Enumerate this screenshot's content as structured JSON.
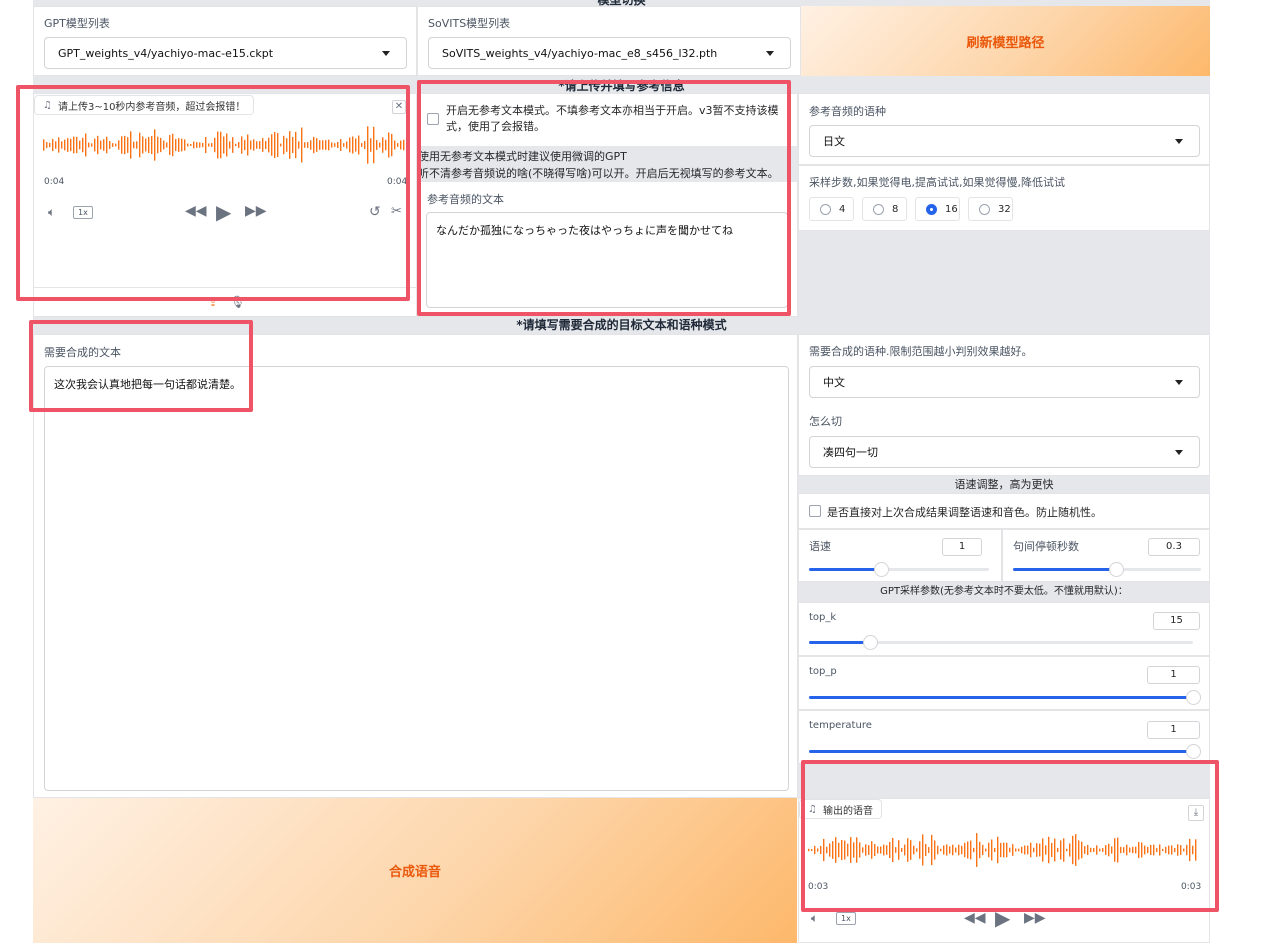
{
  "model_switch": {
    "header": "模型切换",
    "gpt_label": "GPT模型列表",
    "gpt_value": "GPT_weights_v4/yachiyo-mac-e15.ckpt",
    "sovits_label": "SoVITS模型列表",
    "sovits_value": "SoVITS_weights_v4/yachiyo-mac_e8_s456_l32.pth",
    "refresh_label": "刷新模型路径"
  },
  "reference": {
    "header": "*请上传并填写参考信息",
    "audio_tag": "请上传3~10秒内参考音频，超过会报错！",
    "audio_time_start": "0:04",
    "audio_time_end": "0:04",
    "rate": "1x",
    "no_ref_text_label": "开启无参考文本模式。不填参考文本亦相当于开启。v3暂不支持该模式，使用了会报错。",
    "no_ref_hint_1": "使用无参考文本模式时建议使用微调的GPT",
    "no_ref_hint_2": "听不清参考音频说的啥(不晓得写啥)可以开。开启后无视填写的参考文本。",
    "ref_text_label": "参考音频的文本",
    "ref_text_value": "なんだか孤独になっちゃった夜はやっちょに声を聞かせてね",
    "ref_lang_label": "参考音频的语种",
    "ref_lang_value": "日文",
    "steps_label": "采样步数,如果觉得电,提高试试,如果觉得慢,降低试试",
    "steps_options": [
      "4",
      "8",
      "16",
      "32"
    ],
    "steps_selected": "16"
  },
  "target": {
    "header": "*请填写需要合成的目标文本和语种模式",
    "text_label": "需要合成的文本",
    "text_value": "这次我会认真地把每一句话都说清楚。",
    "lang_label": "需要合成的语种.限制范围越小判别效果越好。",
    "lang_value": "中文",
    "cut_label": "怎么切",
    "cut_value": "凑四句一切",
    "speed_header": "语速调整，高为更快",
    "direct_adjust_label": "是否直接对上次合成结果调整语速和音色。防止随机性。",
    "speed_label": "语速",
    "speed_value": "1",
    "speed_fraction": 0.4,
    "pause_label": "句间停顿秒数",
    "pause_value": "0.3",
    "pause_fraction": 0.55,
    "gpt_params_header": "GPT采样参数(无参考文本时不要太低。不懂就用默认)：",
    "top_k_label": "top_k",
    "top_k_value": "15",
    "top_k_fraction": 0.16,
    "top_p_label": "top_p",
    "top_p_value": "1",
    "top_p_fraction": 1.0,
    "temperature_label": "temperature",
    "temperature_value": "1",
    "temperature_fraction": 1.0,
    "synth_label": "合成语音"
  },
  "output": {
    "tag": "输出的语音",
    "time_start": "0:03",
    "time_end": "0:03",
    "rate": "1x"
  },
  "colors": {
    "accent": "#ea580c",
    "waveform": "#f97316",
    "highlight": "#ef5466",
    "slider": "#2563eb"
  }
}
